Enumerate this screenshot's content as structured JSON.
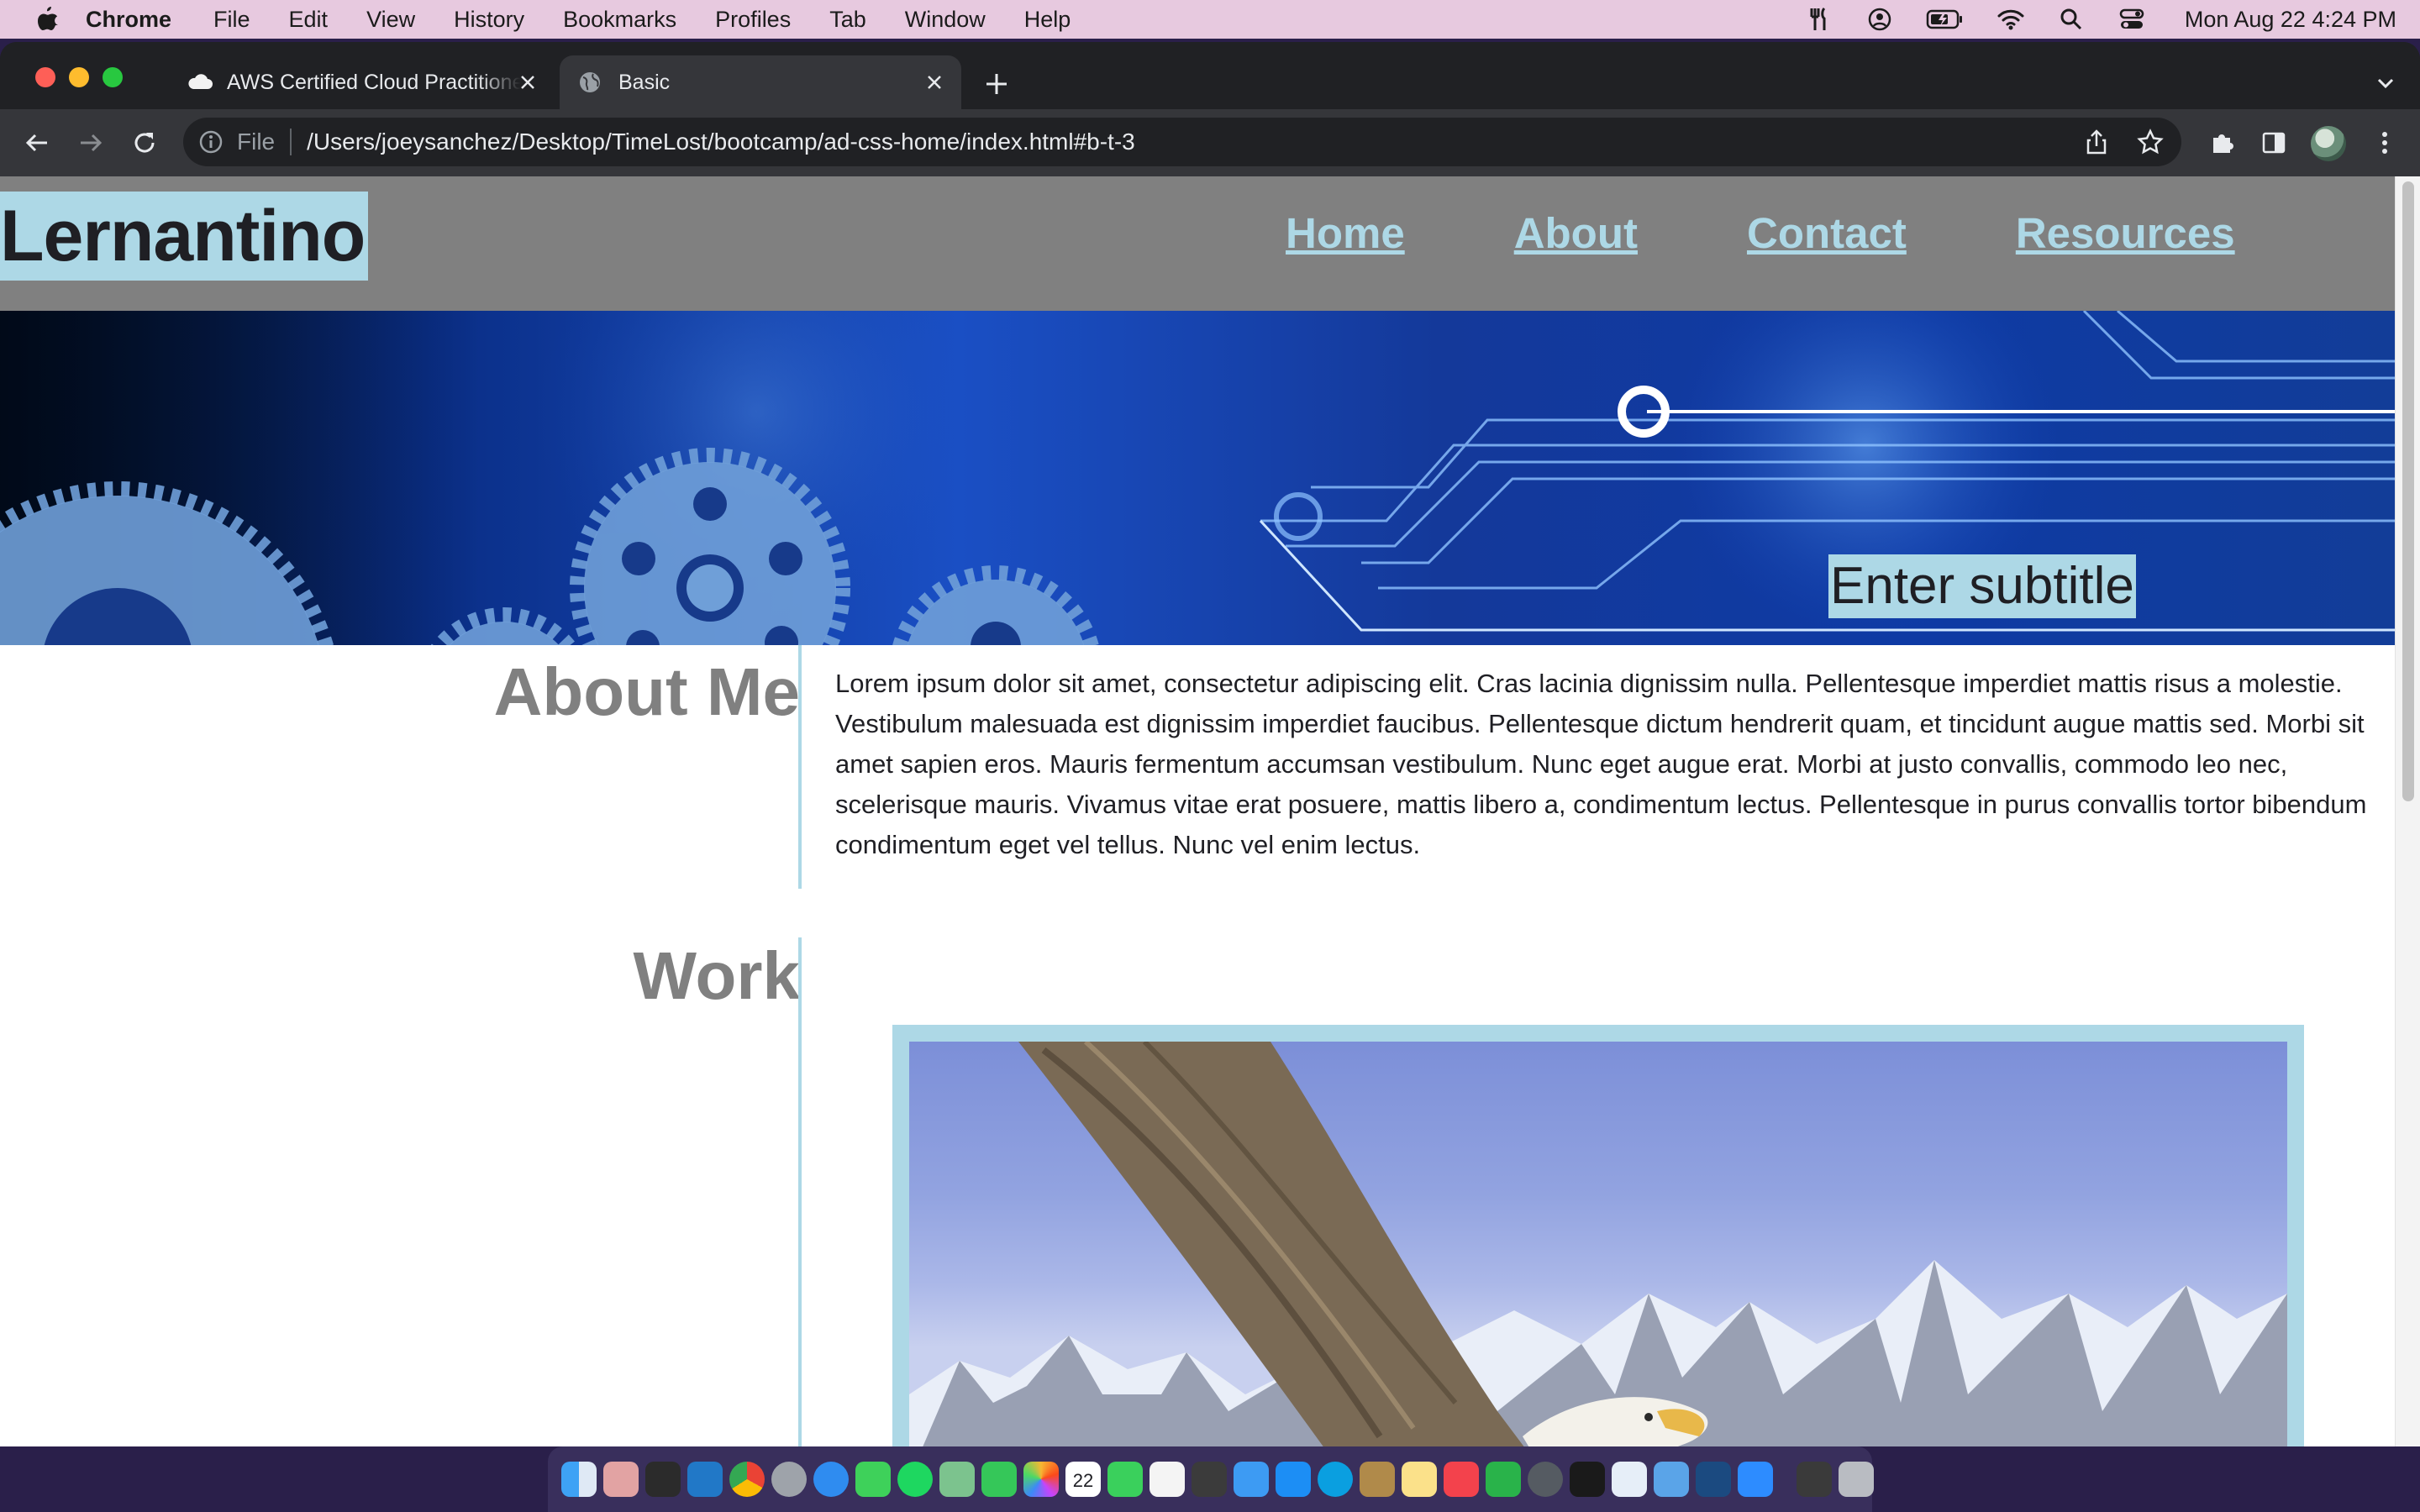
{
  "menubar": {
    "app_name": "Chrome",
    "menus": [
      "File",
      "Edit",
      "View",
      "History",
      "Bookmarks",
      "Profiles",
      "Tab",
      "Window",
      "Help"
    ],
    "clock": "Mon Aug 22  4:24 PM"
  },
  "browser": {
    "tabs": [
      {
        "title": "AWS Certified Cloud Practitioner",
        "icon": "cloud-icon"
      },
      {
        "title": "Basic",
        "icon": "globe-icon"
      }
    ],
    "address": {
      "scheme_label": "File",
      "url": "/Users/joeysanchez/Desktop/TimeLost/bootcamp/ad-css-home/index.html#b-t-3"
    }
  },
  "site": {
    "logo": "Lernantino",
    "nav": [
      "Home",
      "About",
      "Contact",
      "Resources"
    ],
    "hero_subtitle": "Enter subtitle",
    "sections": {
      "about_title": "About Me",
      "about_text": "Lorem ipsum dolor sit amet, consectetur adipiscing elit. Cras lacinia dignissim nulla. Pellentesque imperdiet mattis risus a molestie. Vestibulum malesuada est dignissim imperdiet faucibus. Pellentesque dictum hendrerit quam, et tincidunt augue mattis sed. Morbi sit amet sapien eros. Mauris fermentum accumsan vestibulum. Nunc eget augue erat. Morbi at justo convallis, commodo leo nec, scelerisque mauris. Vivamus vitae erat posuere, mattis libero a, condimentum lectus. Pellentesque in purus convallis tortor bibendum condimentum eget vel tellus. Nunc vel enim lectus.",
      "work_title": "Work"
    }
  },
  "colors": {
    "accent": "#add8e6",
    "header_bg": "#808080",
    "text": "#1f1f24",
    "section_label": "#808080"
  },
  "dock": {
    "apps": [
      "finder-icon",
      "launchpad-icon",
      "terminal-icon",
      "vscode-icon",
      "chrome-icon",
      "system-prefs-icon",
      "safari-icon",
      "messages-icon",
      "spotify-icon",
      "maps-icon",
      "findmy-icon",
      "photos-icon",
      "calendar-icon",
      "facetime-icon",
      "reminders-icon",
      "calculator-icon",
      "mail-icon",
      "appstore-icon",
      "skype-icon",
      "keychain-icon",
      "notes-icon",
      "news-icon",
      "numbers-icon",
      "activity-icon",
      "terminal2-icon",
      "xcode-icon",
      "preview-icon",
      "mysql-icon",
      "zoom-icon",
      "screenshots-icon",
      "trash-icon"
    ],
    "calendar_day": "22"
  }
}
